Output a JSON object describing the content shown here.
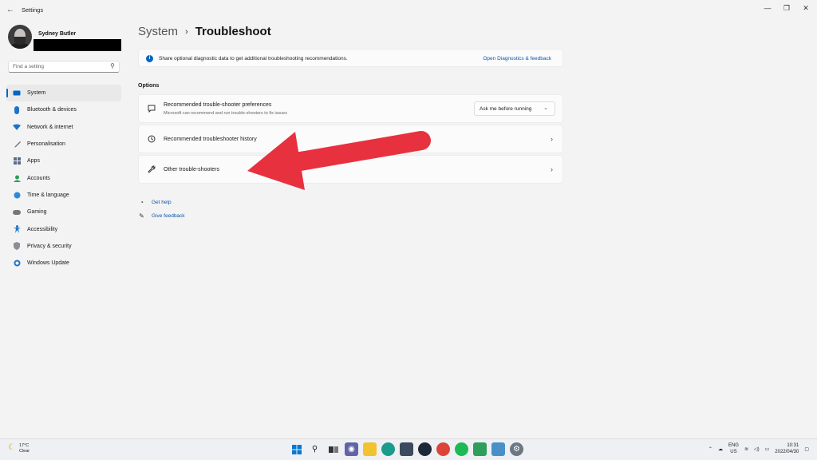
{
  "window": {
    "title": "Settings",
    "back_icon": "back-arrow-icon",
    "controls": [
      "minimize-icon",
      "restore-icon",
      "close-icon"
    ]
  },
  "user": {
    "name": "Sydney Butler"
  },
  "search": {
    "placeholder": "Find a setting"
  },
  "sidebar": {
    "items": [
      {
        "label": "System",
        "icon": "monitor-icon",
        "active": true
      },
      {
        "label": "Bluetooth & devices",
        "icon": "bluetooth-icon"
      },
      {
        "label": "Network & internet",
        "icon": "wifi-icon"
      },
      {
        "label": "Personalisation",
        "icon": "brush-icon"
      },
      {
        "label": "Apps",
        "icon": "apps-icon"
      },
      {
        "label": "Accounts",
        "icon": "person-icon"
      },
      {
        "label": "Time & language",
        "icon": "globe-clock-icon"
      },
      {
        "label": "Gaming",
        "icon": "gamepad-icon"
      },
      {
        "label": "Accessibility",
        "icon": "accessibility-icon"
      },
      {
        "label": "Privacy & security",
        "icon": "shield-icon"
      },
      {
        "label": "Windows Update",
        "icon": "update-icon"
      }
    ]
  },
  "breadcrumb": {
    "parent": "System",
    "separator": "›",
    "current": "Troubleshoot"
  },
  "info_bar": {
    "text": "Share optional diagnostic data to get additional troubleshooting recommendations.",
    "link": "Open Diagnostics & feedback"
  },
  "options": {
    "title": "Options",
    "items": [
      {
        "title": "Recommended trouble-shooter preferences",
        "subtitle": "Microsoft can recommend and run trouble-shooters to fix issues",
        "dropdown_value": "Ask me before running",
        "icon": "chat-bubble-icon"
      },
      {
        "title": "Recommended troubleshooter history",
        "icon": "history-icon"
      },
      {
        "title": "Other trouble-shooters",
        "icon": "wrench-icon"
      }
    ]
  },
  "help": {
    "get_help": "Get help",
    "give_feedback": "Give feedback"
  },
  "taskbar": {
    "weather_temp": "17°C",
    "weather_cond": "Clear",
    "lang_top": "ENG",
    "lang_bottom": "US",
    "time": "10:31",
    "date": "2022/04/30"
  },
  "colors": {
    "accent": "#0067c0",
    "arrow": "#e8313f",
    "link": "#0b57a8"
  }
}
